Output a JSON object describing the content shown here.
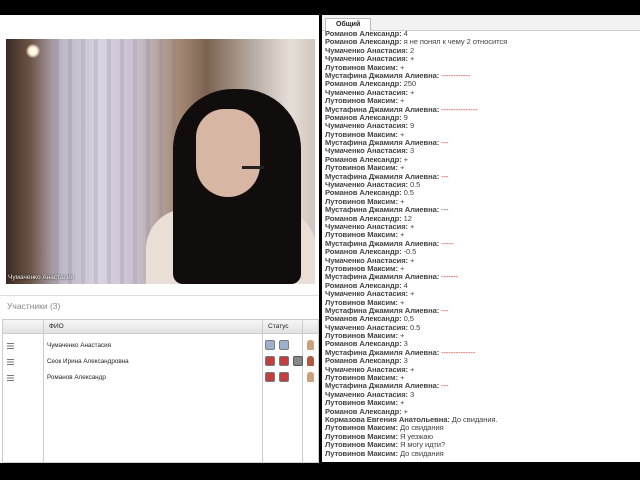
{
  "video": {
    "participant_label": "Чумаченко Анастасия"
  },
  "participants": {
    "title": "Участники (3)",
    "columns": {
      "name": "ФИО",
      "status": "Статус"
    },
    "rows": [
      {
        "name": "Чумаченко Анастасия",
        "status_icons": [
          "camera-icon",
          "headset-icon"
        ],
        "role_color": "#c9a27a"
      },
      {
        "name": "Сеок Ирина Александровна",
        "status_icons": [
          "mic-off-icon",
          "camera-off-icon",
          "cam-icon"
        ],
        "role_color": "#b05a40"
      },
      {
        "name": "Романов Александр",
        "status_icons": [
          "mic-off-icon",
          "camera-off-icon"
        ],
        "role_color": "#c9a27a"
      }
    ]
  },
  "chat": {
    "tab": "Общий",
    "messages": [
      {
        "author": "Романов Александр:",
        "text": "4"
      },
      {
        "author": "Романов Александр:",
        "text": "я не понял к чему 2 относится"
      },
      {
        "author": "Чумаченко Анастасия:",
        "text": "2"
      },
      {
        "author": "Чумаченко Анастасия:",
        "text": "+"
      },
      {
        "author": "Лутовинов Максим:",
        "text": "+"
      },
      {
        "author": "Мустафина Джамиля Алиевна:",
        "text": "------------",
        "red": true
      },
      {
        "author": "Романов Александр:",
        "text": "250"
      },
      {
        "author": "Чумаченко Анастасия:",
        "text": "+"
      },
      {
        "author": "Лутовинов Максим:",
        "text": "+"
      },
      {
        "author": "Мустафина Джамиля Алиевна:",
        "text": "---------------",
        "red": true
      },
      {
        "author": "Романов Александр:",
        "text": "9"
      },
      {
        "author": "Чумаченко Анастасия:",
        "text": "9"
      },
      {
        "author": "Лутовинов Максим:",
        "text": "+"
      },
      {
        "author": "Мустафина Джамиля Алиевна:",
        "text": "---",
        "red": true
      },
      {
        "author": "Чумаченко Анастасия:",
        "text": "3"
      },
      {
        "author": "Романов Александр:",
        "text": "+"
      },
      {
        "author": "Лутовинов Максим:",
        "text": "+"
      },
      {
        "author": "Мустафина Джамиля Алиевна:",
        "text": "---",
        "red": true
      },
      {
        "author": "Чумаченко Анастасия:",
        "text": "0.5"
      },
      {
        "author": "Романов Александр:",
        "text": "0.5"
      },
      {
        "author": "Лутовинов Максим:",
        "text": "+"
      },
      {
        "author": "Мустафина Джамиля Алиевна:",
        "text": "---",
        "red": false
      },
      {
        "author": "Романов Александр:",
        "text": "12"
      },
      {
        "author": "Чумаченко Анастасия:",
        "text": "+"
      },
      {
        "author": "Лутовинов Максим:",
        "text": "+"
      },
      {
        "author": "Мустафина Джамиля Алиевна:",
        "text": "-----",
        "red": true
      },
      {
        "author": "Романов Александр:",
        "text": "-0.5"
      },
      {
        "author": "Чумаченко Анастасия:",
        "text": "+"
      },
      {
        "author": "Лутовинов Максим:",
        "text": "+"
      },
      {
        "author": "Мустафина Джамиля Алиевна:",
        "text": "-------",
        "red": true
      },
      {
        "author": "Романов Александр:",
        "text": "4"
      },
      {
        "author": "Чумаченко Анастасия:",
        "text": "+"
      },
      {
        "author": "Лутовинов Максим:",
        "text": "+"
      },
      {
        "author": "Мустафина Джамиля Алиевна:",
        "text": "---",
        "red": true
      },
      {
        "author": "Романов Александр:",
        "text": "0,5"
      },
      {
        "author": "Чумаченко Анастасия:",
        "text": "0.5"
      },
      {
        "author": "Лутовинов Максим:",
        "text": "+"
      },
      {
        "author": "Романов Александр:",
        "text": "3"
      },
      {
        "author": "Мустафина Джамиля Алиевна:",
        "text": "--------------",
        "red": true
      },
      {
        "author": "Романов Александр:",
        "text": "3"
      },
      {
        "author": "Чумаченко Анастасия:",
        "text": "+"
      },
      {
        "author": "Лутовинов Максим:",
        "text": "+"
      },
      {
        "author": "Мустафина Джамиля Алиевна:",
        "text": "---",
        "red": true
      },
      {
        "author": "Чумаченко Анастасия:",
        "text": "3"
      },
      {
        "author": "Лутовинов Максим:",
        "text": "+"
      },
      {
        "author": "Романов Александр:",
        "text": "+"
      },
      {
        "author": "Кормазова Евгения Анатольевна:",
        "text": "До свидания."
      },
      {
        "author": "Лутовинов Максим:",
        "text": "До свидания"
      },
      {
        "author": "Лутовинов Максим:",
        "text": "Я уезжаю"
      },
      {
        "author": "Лутовинов Максим:",
        "text": "Я могу идти?"
      },
      {
        "author": "Лутовинов Максим:",
        "text": "До свидания"
      }
    ]
  },
  "colors": {
    "chat_dash": "#d0261c",
    "background": "#000000"
  }
}
